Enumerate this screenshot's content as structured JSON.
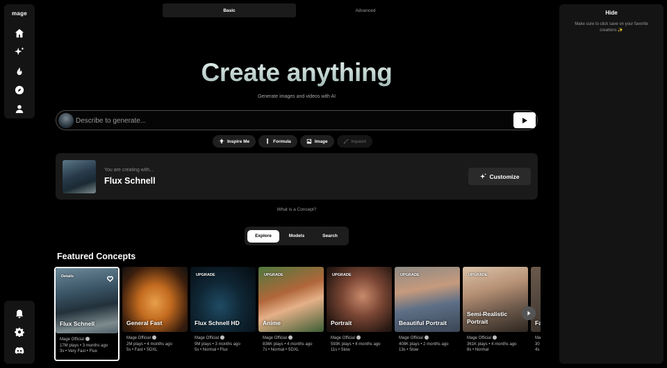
{
  "app": {
    "logo": "mage"
  },
  "rail": {
    "top_icons": [
      "home-icon",
      "sparkles-icon",
      "fire-icon",
      "compass-icon",
      "user-icon"
    ],
    "bottom_icons": [
      "bell-icon",
      "gear-icon",
      "discord-icon"
    ]
  },
  "modes": {
    "basic": "Basic",
    "advanced": "Advanced"
  },
  "hero": {
    "title": "Create anything",
    "subtitle": "Generate images and videos with AI"
  },
  "prompt": {
    "placeholder": "Describe to generate..."
  },
  "chips": [
    {
      "label": "Inspire Me",
      "icon": "bulb-icon",
      "disabled": false
    },
    {
      "label": "Formula",
      "icon": "vial-icon",
      "disabled": false
    },
    {
      "label": "Image",
      "icon": "image-icon",
      "disabled": false
    },
    {
      "label": "Inpaint",
      "icon": "brush-icon",
      "disabled": true
    }
  ],
  "concept": {
    "label": "You are creating with...",
    "name": "Flux Schnell",
    "customize": "Customize"
  },
  "what_is": "What is a Concept?",
  "tabs": [
    {
      "label": "Explore",
      "active": true
    },
    {
      "label": "Models",
      "active": false
    },
    {
      "label": "Search",
      "active": false
    }
  ],
  "featured": {
    "heading": "Featured Concepts",
    "cards": [
      {
        "badge": "Details",
        "title": "Flux Schnell",
        "author": "Mage Official",
        "line2": "17M plays • 3 months ago",
        "line3": "3s • Very Fast • Flux",
        "selected": true
      },
      {
        "badge": "",
        "title": "General Fast",
        "author": "Mage Official",
        "line2": "2M plays • 4 months ago",
        "line3": "5s • Fast • SDXL",
        "selected": false
      },
      {
        "badge": "UPGRADE",
        "title": "Flux Schnell HD",
        "author": "Mage Official",
        "line2": "9M plays • 3 months ago",
        "line3": "5s • Normal • Flux",
        "selected": false
      },
      {
        "badge": "UPGRADE",
        "title": "Anime",
        "author": "Mage Official",
        "line2": "836K plays • 4 months ago",
        "line3": "7s • Normal • SDXL",
        "selected": false
      },
      {
        "badge": "UPGRADE",
        "title": "Portrait",
        "author": "Mage Official",
        "line2": "593K plays • 4 months ago",
        "line3": "11s • Slow",
        "selected": false
      },
      {
        "badge": "UPGRADE",
        "title": "Beautiful Portrait",
        "author": "Mage Official",
        "line2": "408K plays • 2 months ago",
        "line3": "13s • Slow",
        "selected": false
      },
      {
        "badge": "UPGRADE",
        "title": "Semi-Realistic Portrait",
        "author": "Mage Official",
        "line2": "361K plays • 4 months ago",
        "line3": "8s • Normal",
        "selected": false
      },
      {
        "badge": "",
        "title": "Fa",
        "author": "Ma",
        "line2": "30",
        "line3": "4s",
        "selected": false
      }
    ]
  },
  "right_panel": {
    "hide": "Hide",
    "note": "Make sure to click save on your favorite creations ✨"
  }
}
